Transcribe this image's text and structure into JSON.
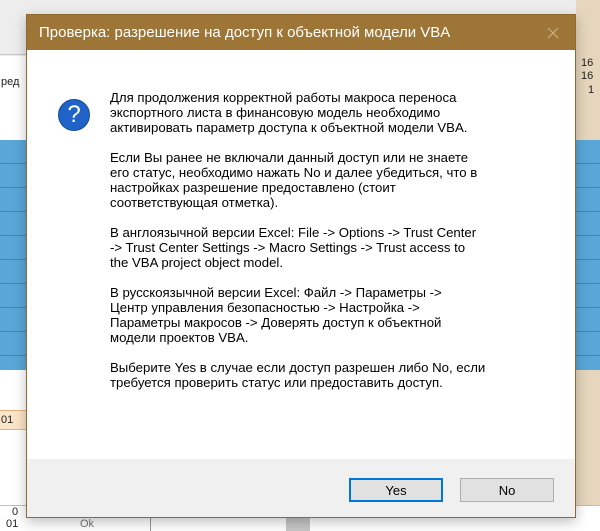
{
  "background": {
    "cells": {
      "right_top_1": "16",
      "right_top_2": "16",
      "right_top_3": "1",
      "left_header": "ред",
      "left_orange": "01",
      "bottom_0": "0",
      "bottom_01": "01",
      "bottom_ok": "Ok"
    }
  },
  "dialog": {
    "title": "Проверка: разрешение на доступ к объектной модели VBA",
    "icon": "question-icon",
    "paragraphs": [
      "Для продолжения корректной работы макроса переноса\nэкспортного листа в финансовую модель необходимо\nактивировать параметр доступа к объектной модели VBA.",
      "Если Вы ранее не включали данный доступ или не знаете\nего статус, необходимо нажать No и далее убедиться, что в\nнастройках разрешение предоставлено (стоит\nсоответствующая отметка).",
      "В англоязычной версии Excel: File -> Options -> Trust Center\n-> Trust Center Settings -> Macro Settings -> Trust access to\nthe VBA project object model.",
      "В русскоязычной версии Excel: Файл -> Параметры ->\nЦентр управления безопасностью -> Настройка ->\nПараметры макросов -> Доверять доступ к объектной\nмодели проектов VBA.",
      "Выберите Yes в случае если доступ разрешен либо No, если\nтребуется проверить статус или предоставить доступ."
    ],
    "buttons": {
      "yes": "Yes",
      "no": "No"
    }
  },
  "colors": {
    "titlebar": "#9d7637",
    "icon_blue": "#1f63c9",
    "focus_border": "#0078d7"
  }
}
